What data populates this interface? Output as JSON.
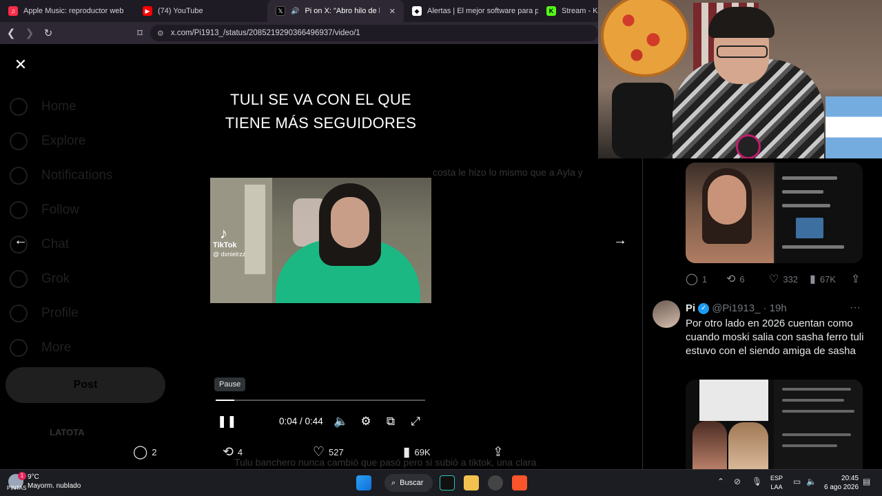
{
  "browser": {
    "tabs": [
      {
        "title": "Apple Music: reproductor web",
        "icon": "apple-music-icon",
        "color": "#fa2d48"
      },
      {
        "title": "(74) YouTube",
        "icon": "youtube-icon",
        "color": "#ff0000"
      },
      {
        "title": "Pi on X: \"Abro hilo de las dive",
        "icon": "x-icon",
        "color": "#000000",
        "active": true
      },
      {
        "title": "Alertas | El mejor software para poten",
        "icon": "alertas-icon",
        "color": "#ffffff"
      },
      {
        "title": "Stream - Kic",
        "icon": "kick-icon",
        "color": "#53fc18"
      }
    ],
    "url": "x.com/Pi1913_/status/2085219290366496937/video/1"
  },
  "sidebar": {
    "items": [
      "Home",
      "Explore",
      "Notifications",
      "Follow",
      "Chat",
      "Grok",
      "Profile",
      "More"
    ],
    "post_label": "Post"
  },
  "background": {
    "snippet": "costa le hizo lo mismo que a Ayla y",
    "footer_text": "Tulu banchero nunca cambió que pasó pero si subió a tiktok, una clara",
    "user_name": "LATOTA"
  },
  "video": {
    "caption_line1": "TULI SE VA CON EL QUE",
    "caption_line2": "TIENE MÁS SEGUIDORES",
    "tiktok_label": "TikTok",
    "tiktok_user": "@ dxnielrzz",
    "pause_tooltip": "Pause",
    "time": "0:04 / 0:44",
    "progress": 0.09
  },
  "actions": {
    "replies": "2",
    "reposts": "4",
    "likes": "527",
    "views": "69K"
  },
  "tweet1_stats": {
    "replies": "1",
    "reposts": "6",
    "likes": "332",
    "views": "67K"
  },
  "tweet2": {
    "name": "Pi",
    "handle": "@Pi1913_",
    "time": "· 19h",
    "text": "Por otro lado en 2026 cuentan como cuando moski salia con sasha ferro tuli estuvo con el siendo amiga de sasha"
  },
  "taskbar": {
    "temp": "9°C",
    "weather": "Mayorm. nublado",
    "brand": "PINTAS",
    "notif_count": "1",
    "search_label": "Buscar",
    "lang1": "ESP",
    "lang2": "LAA",
    "time": "20:45",
    "date": "6 ago 2026"
  }
}
